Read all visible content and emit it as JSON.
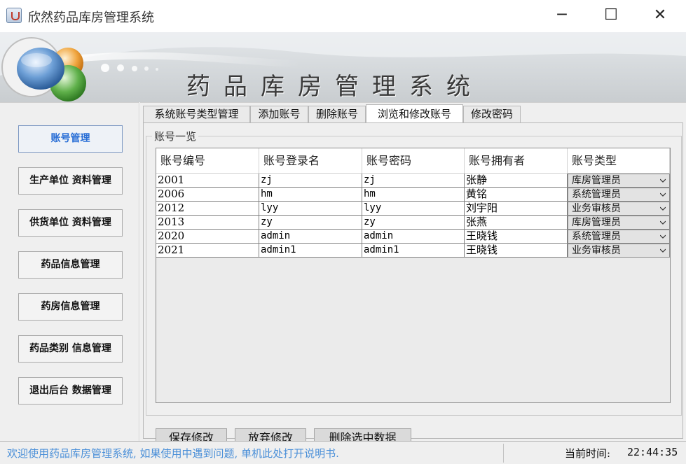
{
  "window": {
    "title": "欣然药品库房管理系统",
    "minimize_symbol": "─",
    "maximize_symbol": "☐",
    "close_symbol": "✕"
  },
  "banner": {
    "title": "药品库房管理系统"
  },
  "nav": {
    "items": [
      {
        "label": "账号管理",
        "active": true
      },
      {
        "label": "生产单位 资料管理",
        "active": false
      },
      {
        "label": "供货单位 资料管理",
        "active": false
      },
      {
        "label": "药品信息管理",
        "active": false
      },
      {
        "label": "药房信息管理",
        "active": false
      },
      {
        "label": "药品类别 信息管理",
        "active": false
      },
      {
        "label": "退出后台 数据管理",
        "active": false
      }
    ]
  },
  "tabs": [
    {
      "label": "系统账号类型管理",
      "active": false
    },
    {
      "label": "添加账号",
      "active": false
    },
    {
      "label": "删除账号",
      "active": false
    },
    {
      "label": "浏览和修改账号",
      "active": true
    },
    {
      "label": "修改密码",
      "active": false
    }
  ],
  "panel": {
    "group_title": "账号一览"
  },
  "table": {
    "columns": [
      "账号编号",
      "账号登录名",
      "账号密码",
      "账号拥有者",
      "账号类型"
    ],
    "rows": [
      [
        "2001",
        "zj",
        "zj",
        "张静",
        "库房管理员"
      ],
      [
        "2006",
        "hm",
        "hm",
        "黄铭",
        "系统管理员"
      ],
      [
        "2012",
        "lyy",
        "lyy",
        "刘宇阳",
        "业务审核员"
      ],
      [
        "2013",
        "zy",
        "zy",
        "张燕",
        "库房管理员"
      ],
      [
        "2020",
        "admin",
        "admin",
        "王晓钱",
        "系统管理员"
      ],
      [
        "2021",
        "admin1",
        "admin1",
        "王晓钱",
        "业务审核员"
      ]
    ]
  },
  "buttons": {
    "save": "保存修改",
    "discard": "放弃修改",
    "delete_selected": "删除选中数据"
  },
  "status": {
    "message": "欢迎使用药品库房管理系统, 如果使用中遇到问题, 单机此处打开说明书.",
    "time_label": "当前时间:",
    "time_value": "22:44:35"
  },
  "colors": {
    "accent_blue": "#2a6fd6",
    "status_text": "#4a8fd8"
  }
}
